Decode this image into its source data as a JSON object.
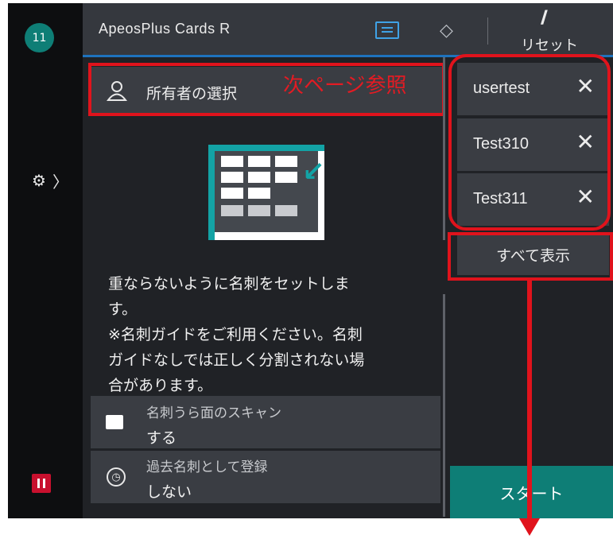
{
  "status": {
    "badge": "11"
  },
  "header": {
    "title": "ApeosPlus Cards R",
    "reset_label": "リセット",
    "reset_symbol": "//"
  },
  "main": {
    "owner_label": "所有者の選択",
    "annotation": "次ページ参照",
    "description_lines": [
      "重ならないように名刺をセットしま",
      "す。",
      "※名刺ガイドをご利用ください。名刺",
      "ガイドなしでは正しく分割されない場",
      "合があります。"
    ],
    "options": [
      {
        "label": "名刺うら面のスキャン",
        "value": "する",
        "icon": "card-flip-icon"
      },
      {
        "label": "過去名刺として登録",
        "value": "しない",
        "icon": "clock-icon"
      }
    ]
  },
  "owners": {
    "chips": [
      "usertest",
      "Test310",
      "Test311"
    ],
    "show_all": "すべて表示"
  },
  "start_label": "スタート",
  "colors": {
    "accent": "#0e7e76",
    "annotation_red": "#e0131c",
    "header_line": "#1e73be"
  }
}
